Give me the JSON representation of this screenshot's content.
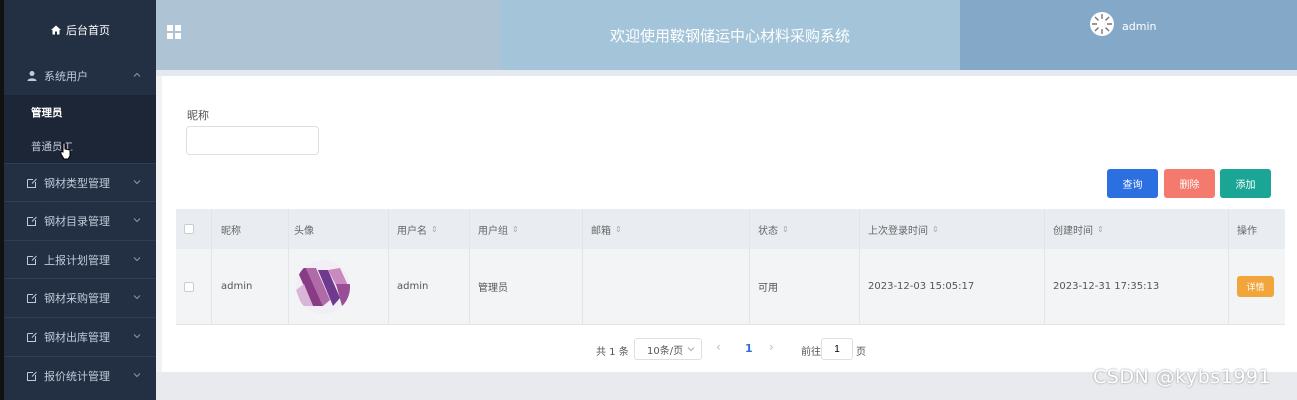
{
  "sidebar": {
    "home": "后台首页",
    "group_user": "系统用户",
    "sub_admin": "管理员",
    "sub_staff": "普通员工",
    "items": [
      "钢材类型管理",
      "钢材目录管理",
      "上报计划管理",
      "钢材采购管理",
      "钢材出库管理",
      "报价统计管理"
    ]
  },
  "header": {
    "title": "欢迎使用鞍钢储运中心材料采购系统",
    "user": "admin"
  },
  "search": {
    "label": "昵称",
    "value": ""
  },
  "toolbar": {
    "query": "查询",
    "delete": "删除",
    "add": "添加"
  },
  "table": {
    "columns": [
      "昵称",
      "头像",
      "用户名",
      "用户组",
      "邮箱",
      "状态",
      "上次登录时间",
      "创建时间",
      "操作"
    ],
    "rows": [
      {
        "nickname": "admin",
        "username": "admin",
        "group": "管理员",
        "email": "",
        "status": "可用",
        "last_login": "2023-12-03 15:05:17",
        "created": "2023-12-31 17:35:13",
        "action": "详情"
      }
    ]
  },
  "pagination": {
    "total": "共 1 条",
    "page_size": "10条/页",
    "current": "1",
    "goto_label": "前往",
    "goto_value": "1",
    "page_suffix": "页"
  },
  "watermark": "CSDN @kybs1991",
  "colors": {
    "sidebar_bg": "#233044",
    "query": "#2c6fe0",
    "delete": "#f47a6d",
    "add": "#1aa595",
    "detail": "#f2a53a"
  }
}
